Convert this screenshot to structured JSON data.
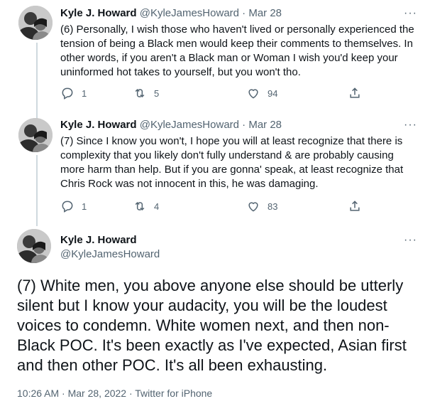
{
  "tweets": [
    {
      "name": "Kyle J. Howard",
      "handle": "@KyleJamesHoward",
      "sep": "·",
      "date": "Mar 28",
      "text": "(6) Personally, I wish those who haven't lived or personally experienced the tension of being a Black men would keep their comments to themselves. In other words, if you aren't a Black man or Woman I wish you'd keep your uninformed hot takes to yourself, but you won't tho.",
      "replies": "1",
      "retweets": "5",
      "likes": "94"
    },
    {
      "name": "Kyle J. Howard",
      "handle": "@KyleJamesHoward",
      "sep": "·",
      "date": "Mar 28",
      "text": "(7) Since I know you won't, I hope you will at least recognize that there is complexity that you likely don't fully understand & are probably causing more harm than help. But if you are gonna' speak, at least recognize that Chris Rock was not innocent in this, he was damaging.",
      "replies": "1",
      "retweets": "4",
      "likes": "83"
    }
  ],
  "main_tweet": {
    "name": "Kyle J. Howard",
    "handle": "@KyleJamesHoward",
    "text": "(7) White men, you above anyone else should be utterly silent but I know your audacity, you will be the loudest voices to condemn. White women next, and then non-Black POC. It's been exactly as I've expected, Asian first and then other POC. It's all been exhausting.",
    "meta": "10:26 AM · Mar 28, 2022 · Twitter for iPhone"
  },
  "more_glyph": "···",
  "icons": [
    "reply-icon",
    "retweet-icon",
    "like-icon",
    "share-icon",
    "more-icon",
    "avatar"
  ],
  "colors": {
    "text": "#0f1419",
    "secondary": "#536471",
    "thread_line": "#cfd9de"
  }
}
